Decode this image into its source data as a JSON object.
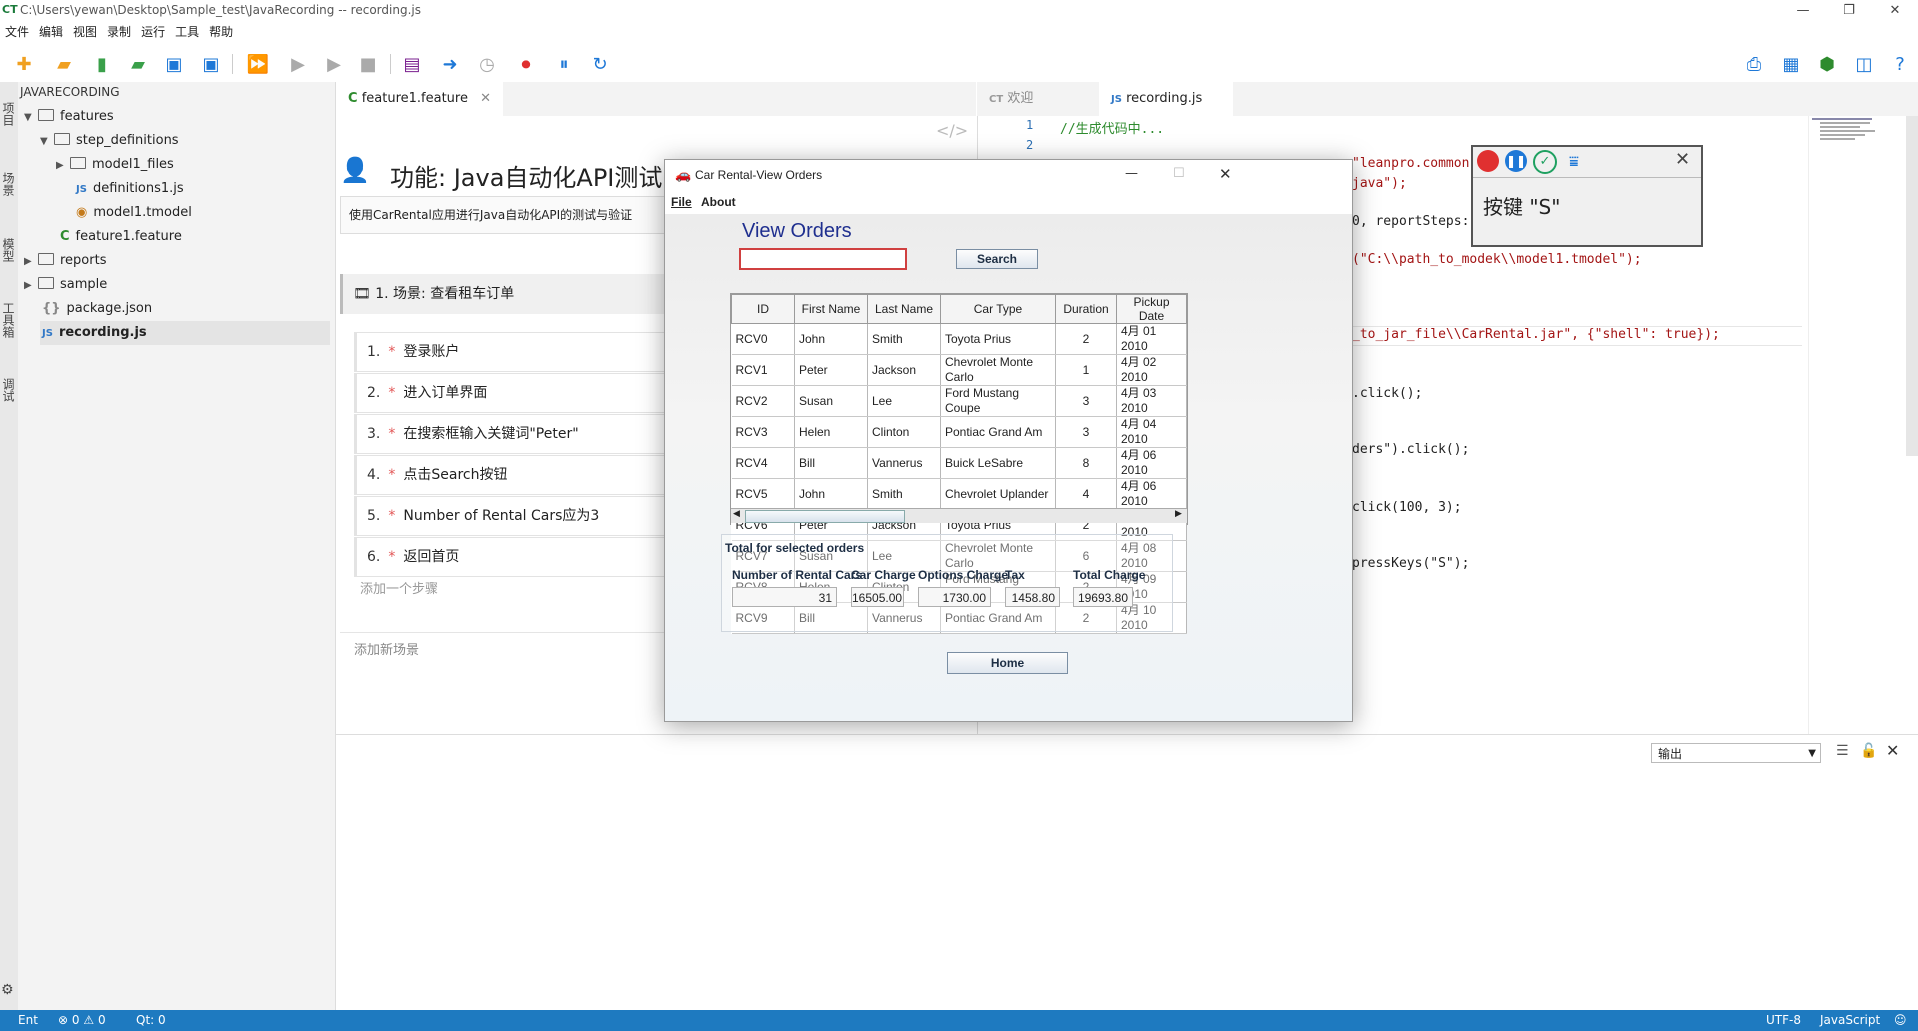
{
  "window": {
    "logo": "CT",
    "title": "C:\\Users\\yewan\\Desktop\\Sample_test\\JavaRecording -- recording.js"
  },
  "menu": [
    "文件",
    "编辑",
    "视图",
    "录制",
    "运行",
    "工具",
    "帮助"
  ],
  "activity": [
    "项目",
    "场景",
    "模型",
    "工具箱",
    "调试"
  ],
  "explorer": {
    "header": "JAVARECORDING",
    "items": [
      {
        "label": "features"
      },
      {
        "label": "step_definitions"
      },
      {
        "label": "model1_files"
      },
      {
        "label": "definitions1.js"
      },
      {
        "label": "model1.tmodel"
      },
      {
        "label": "feature1.feature"
      },
      {
        "label": "reports"
      },
      {
        "label": "sample"
      },
      {
        "label": "package.json"
      },
      {
        "label": "recording.js"
      }
    ]
  },
  "left_tab": {
    "label": "feature1.feature"
  },
  "feature": {
    "title": "功能: Java自动化API测试",
    "description": "使用CarRental应用进行Java自动化API的测试与验证",
    "scenario": "1. 场景: 查看租车订单",
    "steps": [
      {
        "num": "1.",
        "text": "登录账户"
      },
      {
        "num": "2.",
        "text": "进入订单界面"
      },
      {
        "num": "3.",
        "text": "在搜索框输入关键词\"Peter\""
      },
      {
        "num": "4.",
        "text": "点击Search按钮"
      },
      {
        "num": "5.",
        "text": "Number of Rental Cars应为3"
      },
      {
        "num": "6.",
        "text": "返回首页"
      }
    ],
    "add_step": "添加一个步骤",
    "add_scenario": "添加新场景"
  },
  "right_tabs": [
    {
      "label": "欢迎"
    },
    {
      "label": "recording.js"
    }
  ],
  "code": {
    "line_numbers": [
      "1",
      "2"
    ],
    "lines": [
      "//生成代码中...",
      "\"leanpro.common",
      "java\");",
      "0, reportSteps:",
      "(\"C:\\\\path_to_modek\\\\model1.tmodel\");",
      "_to_jar_file\\\\CarRental.jar\", {\"shell\": true});",
      ".click();",
      "ders\").click();",
      "click(100, 3);",
      "pressKeys(\"S\");"
    ]
  },
  "output_panel": {
    "select_value": "输出"
  },
  "status": {
    "left": "Ent",
    "errors": "0",
    "warnings": "0",
    "qt": "Qt: 0",
    "encoding": "UTF-8",
    "language": "JavaScript"
  },
  "dialog": {
    "title": "Car Rental-View Orders",
    "menu": [
      "File",
      "About"
    ],
    "heading": "View Orders",
    "search_value": "",
    "search_button": "Search",
    "columns": [
      "ID",
      "First Name",
      "Last Name",
      "Car Type",
      "Duration",
      "Pickup Date"
    ],
    "rows": [
      [
        "RCV0",
        "John",
        "Smith",
        "Toyota Prius",
        "2",
        "4月 01 2010"
      ],
      [
        "RCV1",
        "Peter",
        "Jackson",
        "Chevrolet Monte Carlo",
        "1",
        "4月 02 2010"
      ],
      [
        "RCV2",
        "Susan",
        "Lee",
        "Ford Mustang Coupe",
        "3",
        "4月 03 2010"
      ],
      [
        "RCV3",
        "Helen",
        "Clinton",
        "Pontiac Grand Am",
        "3",
        "4月 04 2010"
      ],
      [
        "RCV4",
        "Bill",
        "Vannerus",
        "Buick LeSabre",
        "8",
        "4月 06 2010"
      ],
      [
        "RCV5",
        "John",
        "Smith",
        "Chevrolet Uplander",
        "4",
        "4月 06 2010"
      ],
      [
        "RCV6",
        "Peter",
        "Jackson",
        "Toyota Prius",
        "2",
        "4月 07 2010"
      ],
      [
        "RCV7",
        "Susan",
        "Lee",
        "Chevrolet Monte Carlo",
        "6",
        "4月 08 2010"
      ],
      [
        "RCV8",
        "Helen",
        "Clinton",
        "Ford Mustang Coupe",
        "2",
        "4月 09 2010"
      ],
      [
        "RCV9",
        "Bill",
        "Vannerus",
        "Pontiac Grand Am",
        "2",
        "4月 10 2010"
      ]
    ],
    "totals_title": "Total for selected orders",
    "totals_labels": [
      "Number of Rental Cars",
      "Car Charge",
      "Options Charge",
      "Tax",
      "Total Charge"
    ],
    "totals_values": [
      "31",
      "16505.00",
      "1730.00",
      "1458.80",
      "19693.80"
    ],
    "home_button": "Home"
  },
  "recorder": {
    "message": "按键 \"S\""
  },
  "colors": {
    "accent": "#1e7ac0",
    "dialog_heading": "#1f2f8f",
    "record_red": "#e03030",
    "pause_blue": "#1e78d7",
    "check_green": "#1ea060"
  }
}
